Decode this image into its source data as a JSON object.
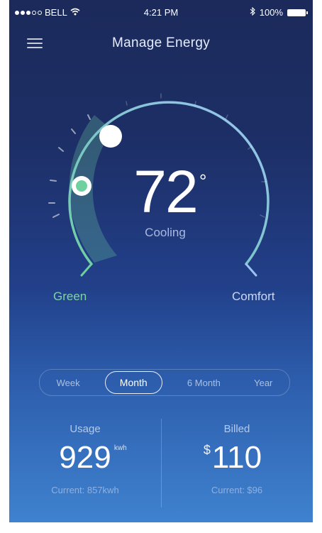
{
  "status_bar": {
    "carrier": "BELL",
    "time": "4:21 PM",
    "battery": "100%"
  },
  "nav": {
    "title": "Manage Energy"
  },
  "thermostat": {
    "temperature": "72",
    "degree_symbol": "°",
    "mode": "Cooling",
    "left_label": "Green",
    "right_label": "Comfort",
    "colors": {
      "green": "#6fd0a0",
      "comfort": "#9cc4f2"
    }
  },
  "period_tabs": {
    "items": [
      "Week",
      "Month",
      "6 Month",
      "Year"
    ],
    "selected": "Month"
  },
  "stats": {
    "usage": {
      "label": "Usage",
      "value": "929",
      "unit": "kwh",
      "current": "Current: 857kwh"
    },
    "billed": {
      "label": "Billed",
      "currency": "$",
      "value": "110",
      "current": "Current: $96"
    }
  }
}
